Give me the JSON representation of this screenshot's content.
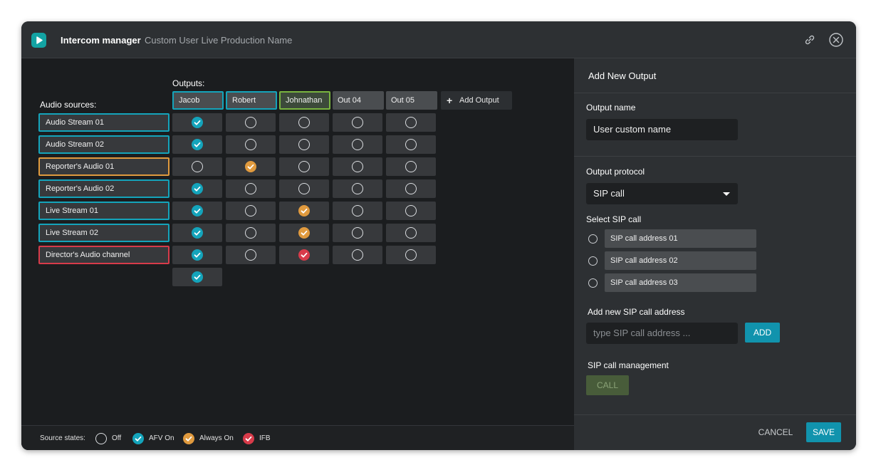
{
  "app": {
    "title": "Intercom manager",
    "production_name": "Custom User Live Production Name"
  },
  "matrix": {
    "outputs_label": "Outputs:",
    "sources_label": "Audio sources:",
    "add_output_label": "Add Output",
    "outputs": [
      {
        "name": "Jacob",
        "border": "teal"
      },
      {
        "name": "Robert",
        "border": "teal"
      },
      {
        "name": "Johnathan",
        "border": "green"
      },
      {
        "name": "Out 04",
        "border": "none"
      },
      {
        "name": "Out 05",
        "border": "none"
      }
    ],
    "sources": [
      {
        "name": "Audio Stream 01",
        "color": "#14a4bb",
        "states": [
          "afv",
          "off",
          "off",
          "off",
          "off"
        ]
      },
      {
        "name": "Audio Stream 02",
        "color": "#14a4bb",
        "states": [
          "afv",
          "off",
          "off",
          "off",
          "off"
        ]
      },
      {
        "name": "Reporter's Audio 01",
        "color": "#e09a3e",
        "states": [
          "off",
          "on",
          "off",
          "off",
          "off"
        ]
      },
      {
        "name": "Reporter's Audio 02",
        "color": "#14a4bb",
        "states": [
          "afv",
          "off",
          "off",
          "off",
          "off"
        ]
      },
      {
        "name": "Live Stream 01",
        "color": "#14a4bb",
        "states": [
          "afv",
          "off",
          "on",
          "off",
          "off"
        ]
      },
      {
        "name": "Live Stream 02",
        "color": "#14a4bb",
        "states": [
          "afv",
          "off",
          "on",
          "off",
          "off"
        ]
      },
      {
        "name": "Director's Audio channel",
        "color": "#d83b4a",
        "states": [
          "afv",
          "off",
          "ifb",
          "off",
          "off"
        ]
      }
    ],
    "extra_row_state": "afv"
  },
  "legend": {
    "title": "Source states:",
    "items": [
      {
        "state": "off",
        "label": "Off"
      },
      {
        "state": "afv",
        "label": "AFV On"
      },
      {
        "state": "on",
        "label": "Always On"
      },
      {
        "state": "ifb",
        "label": "IFB"
      }
    ]
  },
  "colors": {
    "afv": "#14a4bb",
    "always_on": "#e09a3e",
    "ifb": "#d83b4a",
    "green_border": "#79b53f"
  },
  "panel": {
    "title": "Add New Output",
    "output_name_label": "Output name",
    "output_name_value": "User custom name",
    "protocol_label": "Output protocol",
    "protocol_value": "SIP call",
    "select_sip_label": "Select SIP call",
    "sip_addresses": [
      "SIP call address 01",
      "SIP call address 02",
      "SIP call address 03"
    ],
    "add_sip_label": "Add new SIP call address",
    "add_sip_placeholder": "type SIP call address ...",
    "add_button": "ADD",
    "sip_mgmt_label": "SIP call management",
    "call_button": "CALL",
    "cancel_button": "CANCEL",
    "save_button": "SAVE"
  }
}
